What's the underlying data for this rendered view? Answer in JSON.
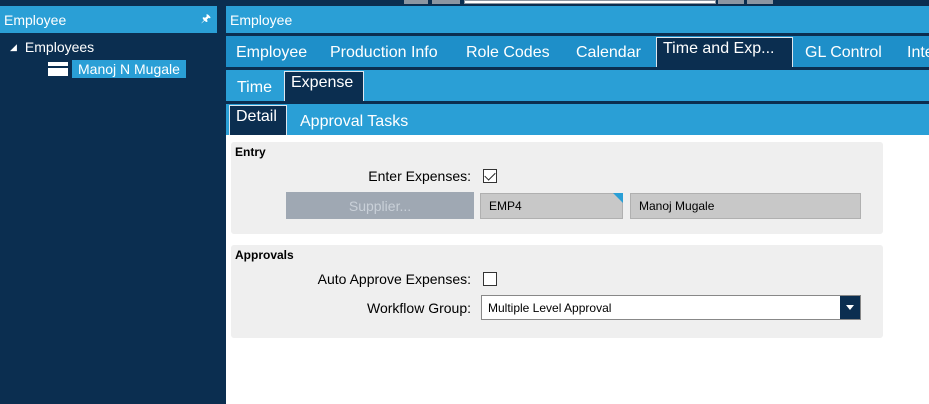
{
  "left_pane": {
    "title": "Employee",
    "pin_icon": "pin-icon",
    "tree": {
      "root_label": "Employees",
      "child_label": "Manoj N Mugale"
    }
  },
  "right_pane": {
    "title": "Employee",
    "main_tabs": [
      {
        "label": "Employee"
      },
      {
        "label": "Production Info"
      },
      {
        "label": "Role Codes"
      },
      {
        "label": "Calendar"
      },
      {
        "label": "Time and Exp..."
      },
      {
        "label": "GL Control"
      },
      {
        "label": "Inte"
      }
    ],
    "active_main_tab": "Time and Exp...",
    "sub_tabs": [
      {
        "label": "Time"
      },
      {
        "label": "Expense"
      }
    ],
    "active_sub_tab": "Expense",
    "detail_tabs": [
      {
        "label": "Detail"
      },
      {
        "label": "Approval Tasks"
      }
    ],
    "active_detail_tab": "Detail"
  },
  "entry": {
    "section_title": "Entry",
    "enter_expenses_label": "Enter Expenses:",
    "enter_expenses_checked": true,
    "supplier_button_label": "Supplier...",
    "supplier_code": "EMP4",
    "supplier_name": "Manoj Mugale"
  },
  "approvals": {
    "section_title": "Approvals",
    "auto_approve_label": "Auto Approve Expenses:",
    "auto_approve_checked": false,
    "workflow_group_label": "Workflow Group:",
    "workflow_group_value": "Multiple Level Approval"
  },
  "colors": {
    "navy": "#0b2e50",
    "accent_blue": "#2a9fd6",
    "panel_gray": "#efefef"
  }
}
